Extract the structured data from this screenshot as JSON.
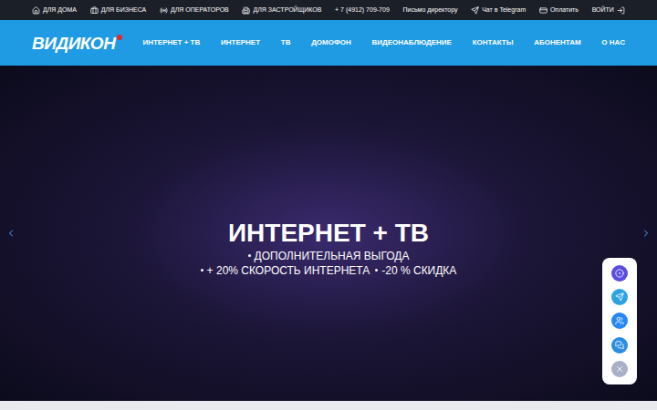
{
  "topbar": {
    "left": [
      {
        "label": "ДЛЯ ДОМА",
        "icon": "home"
      },
      {
        "label": "ДЛЯ БИЗНЕСА",
        "icon": "business"
      },
      {
        "label": "ДЛЯ ОПЕРАТОРОВ",
        "icon": "operators"
      },
      {
        "label": "ДЛЯ ЗАСТРОЙЩИКОВ",
        "icon": "builders"
      },
      {
        "label": "+ 7 (4912) 709-709",
        "icon": "none"
      },
      {
        "label": "Письмо директору",
        "icon": "none"
      },
      {
        "label": "Чат в Telegram",
        "icon": "telegram"
      },
      {
        "label": "Оплатить",
        "icon": "pay"
      }
    ],
    "login": "ВОЙТИ"
  },
  "logo": "ВИДИКОН",
  "nav": [
    {
      "label": "ИНТЕРНЕТ + ТВ"
    },
    {
      "label": "ИНТЕРНЕТ"
    },
    {
      "label": "ТВ"
    },
    {
      "label": "ДОМОФОН"
    },
    {
      "label": "ВИДЕОНАБЛЮДЕНИЕ"
    },
    {
      "label": "КОНТАКТЫ"
    },
    {
      "label": "АБОНЕНТАМ"
    },
    {
      "label": "О НАС"
    }
  ],
  "hero": {
    "title": "ИНТЕРНЕТ + ТВ",
    "lines": [
      [
        "ДОПОЛНИТЕЛЬНАЯ ВЫГОДА"
      ],
      [
        "+ 20% СКОРОСТЬ ИНТЕРНЕТА",
        "-20 % СКИДКА"
      ]
    ]
  },
  "widgets": [
    {
      "icon": "max",
      "color": "#5b4de0"
    },
    {
      "icon": "telegram",
      "color": "#2aa3e0"
    },
    {
      "icon": "vk",
      "color": "#2787f5"
    },
    {
      "icon": "chat",
      "color": "#2a8ee0"
    },
    {
      "icon": "close",
      "color": "#a8b0c8"
    }
  ]
}
